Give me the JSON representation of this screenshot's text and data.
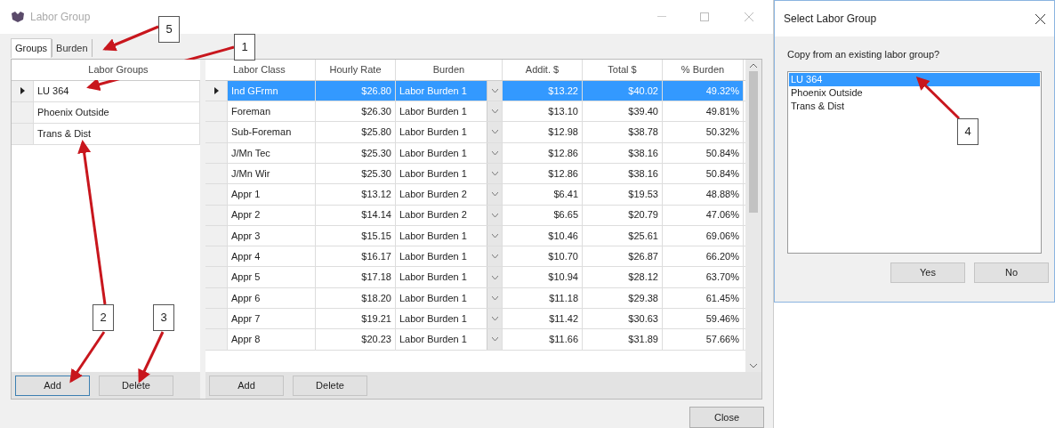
{
  "window": {
    "title": "Labor Group"
  },
  "tabs": [
    {
      "label": "Groups",
      "selected": true
    },
    {
      "label": "Burden",
      "selected": false
    }
  ],
  "groups": {
    "column": "Labor Groups",
    "rows": [
      {
        "name": "LU 364",
        "current": true
      },
      {
        "name": "Phoenix Outside",
        "current": false
      },
      {
        "name": "Trans & Dist",
        "current": false
      }
    ],
    "buttons": [
      "Add",
      "Delete"
    ]
  },
  "classes": {
    "columns": [
      "Labor Class",
      "Hourly Rate",
      "Burden",
      "Addit. $",
      "Total $",
      "% Burden"
    ],
    "rows": [
      {
        "cells": [
          "Ind GFrmn",
          "$26.80",
          "Labor Burden 1",
          "$13.22",
          "$40.02",
          "49.32%"
        ],
        "selected": true
      },
      {
        "cells": [
          "Foreman",
          "$26.30",
          "Labor Burden 1",
          "$13.10",
          "$39.40",
          "49.81%"
        ],
        "selected": false
      },
      {
        "cells": [
          "Sub-Foreman",
          "$25.80",
          "Labor Burden 1",
          "$12.98",
          "$38.78",
          "50.32%"
        ],
        "selected": false
      },
      {
        "cells": [
          "J/Mn Tec",
          "$25.30",
          "Labor Burden 1",
          "$12.86",
          "$38.16",
          "50.84%"
        ],
        "selected": false
      },
      {
        "cells": [
          "J/Mn Wir",
          "$25.30",
          "Labor Burden 1",
          "$12.86",
          "$38.16",
          "50.84%"
        ],
        "selected": false
      },
      {
        "cells": [
          "Appr 1",
          "$13.12",
          "Labor Burden 2",
          "$6.41",
          "$19.53",
          "48.88%"
        ],
        "selected": false
      },
      {
        "cells": [
          "Appr 2",
          "$14.14",
          "Labor Burden 2",
          "$6.65",
          "$20.79",
          "47.06%"
        ],
        "selected": false
      },
      {
        "cells": [
          "Appr 3",
          "$15.15",
          "Labor Burden 1",
          "$10.46",
          "$25.61",
          "69.06%"
        ],
        "selected": false
      },
      {
        "cells": [
          "Appr 4",
          "$16.17",
          "Labor Burden 1",
          "$10.70",
          "$26.87",
          "66.20%"
        ],
        "selected": false
      },
      {
        "cells": [
          "Appr 5",
          "$17.18",
          "Labor Burden 1",
          "$10.94",
          "$28.12",
          "63.70%"
        ],
        "selected": false
      },
      {
        "cells": [
          "Appr 6",
          "$18.20",
          "Labor Burden 1",
          "$11.18",
          "$29.38",
          "61.45%"
        ],
        "selected": false
      },
      {
        "cells": [
          "Appr 7",
          "$19.21",
          "Labor Burden 1",
          "$11.42",
          "$30.63",
          "59.46%"
        ],
        "selected": false
      },
      {
        "cells": [
          "Appr 8",
          "$20.23",
          "Labor Burden 1",
          "$11.66",
          "$31.89",
          "57.66%"
        ],
        "selected": false
      }
    ],
    "buttons": [
      "Add",
      "Delete"
    ]
  },
  "close_button": "Close",
  "dialog": {
    "title": "Select Labor Group",
    "prompt": "Copy from an existing labor group?",
    "items": [
      {
        "label": "LU 364",
        "selected": true
      },
      {
        "label": "Phoenix Outside",
        "selected": false
      },
      {
        "label": "Trans & Dist",
        "selected": false
      }
    ],
    "buttons": [
      "Yes",
      "No"
    ]
  },
  "annotations": [
    {
      "label": "1"
    },
    {
      "label": "2"
    },
    {
      "label": "3"
    },
    {
      "label": "4"
    },
    {
      "label": "5"
    }
  ]
}
